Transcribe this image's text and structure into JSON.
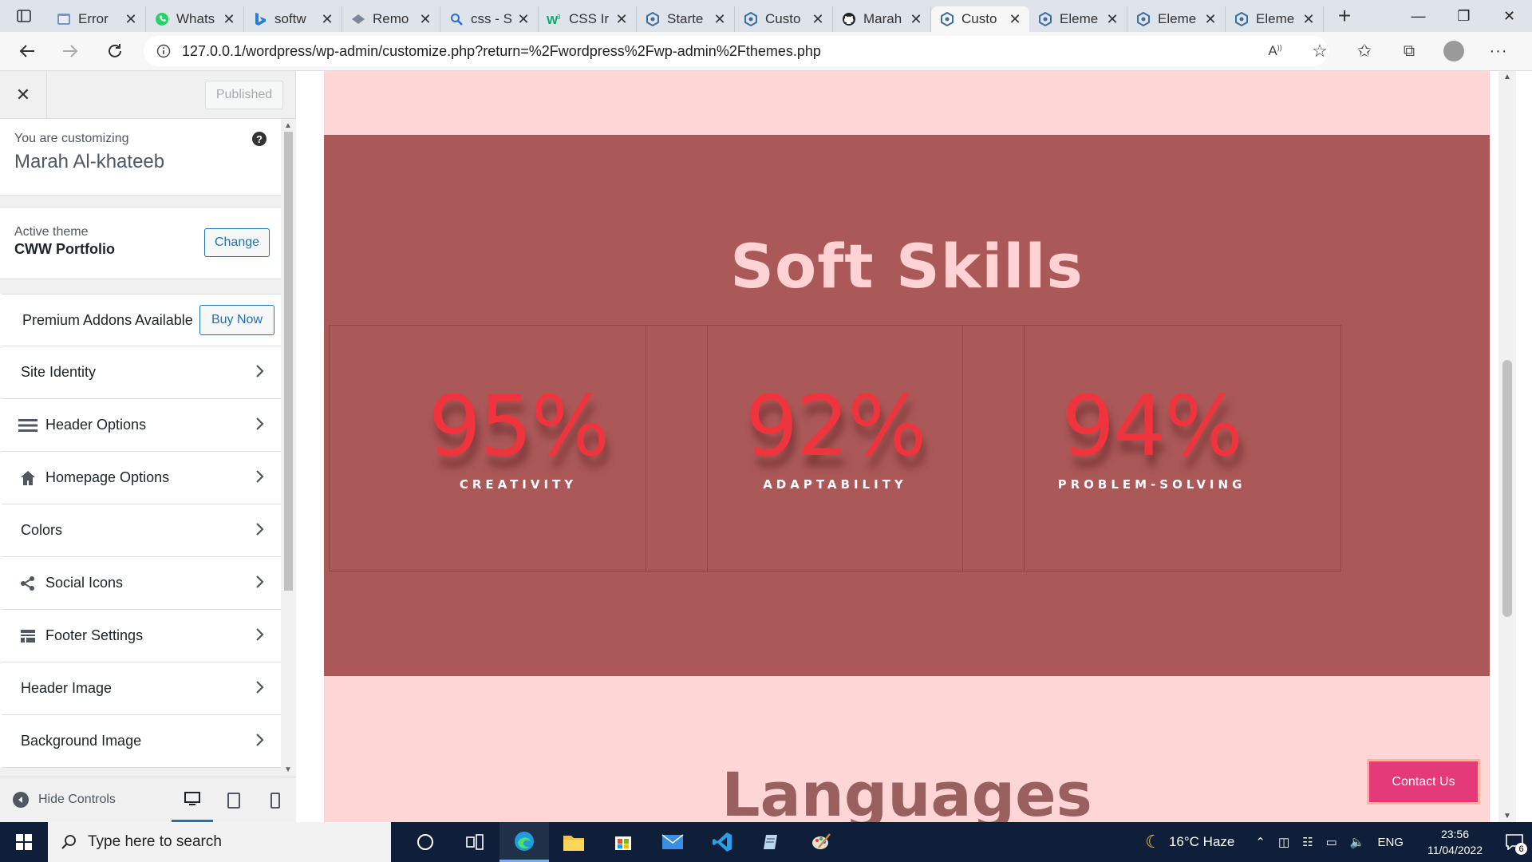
{
  "browser": {
    "tabs": [
      {
        "title": "Error",
        "icon": "page-icon"
      },
      {
        "title": "Whats",
        "icon": "whatsapp-icon"
      },
      {
        "title": "softw",
        "icon": "bing-icon"
      },
      {
        "title": "Remo",
        "icon": "remove-bg-icon"
      },
      {
        "title": "css - S",
        "icon": "search-icon"
      },
      {
        "title": "CSS Ir",
        "icon": "w3schools-icon"
      },
      {
        "title": "Starte",
        "icon": "wordpress-icon"
      },
      {
        "title": "Custo",
        "icon": "wordpress-icon"
      },
      {
        "title": "Marah",
        "icon": "github-icon"
      },
      {
        "title": "Custo",
        "icon": "wordpress-icon",
        "active": true
      },
      {
        "title": "Eleme",
        "icon": "wordpress-icon"
      },
      {
        "title": "Eleme",
        "icon": "wordpress-icon"
      },
      {
        "title": "Eleme",
        "icon": "wordpress-icon"
      }
    ],
    "url": "127.0.0.1/wordpress/wp-admin/customize.php?return=%2Fwordpress%2Fwp-admin%2Fthemes.php"
  },
  "customizer": {
    "published_label": "Published",
    "customizing_label": "You are customizing",
    "site_name": "Marah Al-khateeb",
    "help_glyph": "?",
    "active_theme_label": "Active theme",
    "theme_name": "CWW Portfolio",
    "change_label": "Change",
    "premium_label": "Premium Addons Available",
    "buy_now_label": "Buy Now",
    "sections": [
      {
        "label": "Site Identity",
        "icon": ""
      },
      {
        "label": "Header Options",
        "icon": "menu-icon"
      },
      {
        "label": "Homepage Options",
        "icon": "home-icon"
      },
      {
        "label": "Colors",
        "icon": ""
      },
      {
        "label": "Social Icons",
        "icon": "share-icon"
      },
      {
        "label": "Footer Settings",
        "icon": "footer-icon"
      },
      {
        "label": "Header Image",
        "icon": ""
      },
      {
        "label": "Background Image",
        "icon": ""
      }
    ],
    "hide_controls_label": "Hide Controls",
    "active_device": "desktop"
  },
  "preview": {
    "skills_title": "Soft Skills",
    "skills": [
      {
        "percent": "95%",
        "label": "CREATIVITY"
      },
      {
        "percent": "92%",
        "label": "ADAPTABILITY"
      },
      {
        "percent": "94%",
        "label": "PROBLEM-SOLVING"
      }
    ],
    "languages_title": "Languages",
    "contact_label": "Contact Us",
    "colors": {
      "section_bg": "#ab5858",
      "page_bg": "#ffd6d6",
      "percent": "#f0343e",
      "contact_btn": "#e53a7a"
    }
  },
  "taskbar": {
    "search_placeholder": "Type here to search",
    "weather": "16°C  Haze",
    "language": "ENG",
    "time": "23:56",
    "date": "11/04/2022",
    "notification_count": "6"
  }
}
